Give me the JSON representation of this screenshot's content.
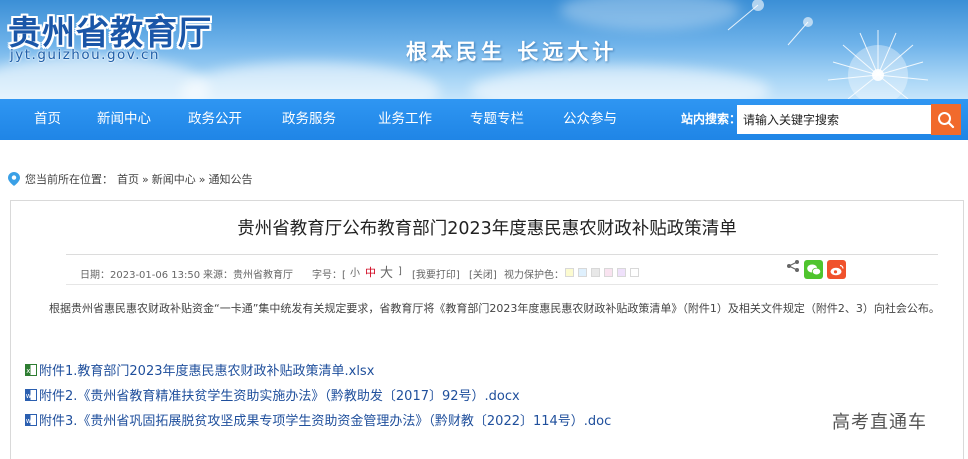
{
  "header": {
    "site_title": "贵州省教育厅",
    "site_domain": "jyt.guizhou.gov.cn",
    "slogan": "根本民生 长远大计"
  },
  "nav": {
    "items": [
      {
        "label": "首页"
      },
      {
        "label": "新闻中心"
      },
      {
        "label": "政务公开"
      },
      {
        "label": "政务服务"
      },
      {
        "label": "业务工作"
      },
      {
        "label": "专题专栏"
      },
      {
        "label": "公众参与"
      }
    ],
    "search_label": "站内搜索：",
    "search_placeholder": "请输入关键字搜索"
  },
  "breadcrumb": {
    "prefix": "您当前所在位置：",
    "items": [
      "首页",
      "新闻中心",
      "通知公告"
    ],
    "separator": "»"
  },
  "article": {
    "title": "贵州省教育厅公布教育部门2023年度惠民惠农财政补贴政策清单",
    "date": "日期：2023-01-06 13:50",
    "source": "来源：贵州省教育厅",
    "font_size_label": "字号：[",
    "font_small": "小",
    "font_medium": "中",
    "font_large": "大",
    "font_size_close": "]",
    "print_link": "[我要打印]",
    "close_link": "[关闭]",
    "eye_protector_label": "视力保护色：",
    "eye_colors": [
      "#fcfbd0",
      "#dff0fd",
      "#e8e8e8",
      "#f9e3f0",
      "#efe1fb",
      "#ffffff"
    ],
    "body": "根据贵州省惠民惠农财政补贴资金“一卡通”集中统发有关规定要求，省教育厅将《教育部门2023年度惠民惠农财政补贴政策清单》（附件1）及相关文件规定（附件2、3）向社会公布。",
    "attachments": [
      {
        "label": "附件1.教育部门2023年度惠民惠农财政补贴政策清单.xlsx",
        "icon": "excel-file-icon"
      },
      {
        "label": "附件2.《贵州省教育精准扶贫学生资助实施办法》（黔教助发〔2017〕92号）.docx",
        "icon": "word-file-icon"
      },
      {
        "label": "附件3.《贵州省巩固拓展脱贫攻坚成果专项学生资助资金管理办法》（黔财教〔2022〕114号）.doc",
        "icon": "word-file-icon"
      }
    ]
  },
  "watermark": "高考直通车",
  "colors": {
    "nav_bg": "#2a90ee",
    "search_button": "#f16a2c",
    "link": "#1f4f9c",
    "font_size_active": "#d0021b"
  }
}
